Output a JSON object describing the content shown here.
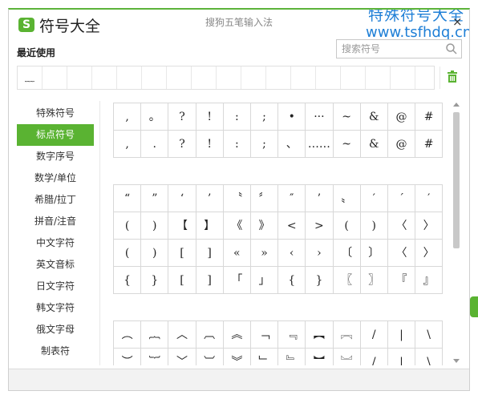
{
  "window": {
    "title": "符号大全",
    "subtitle": "搜狗五笔输入法",
    "logo_letter": "S",
    "close_glyph": "×"
  },
  "watermark": {
    "line1": "特殊符号大全",
    "line2": "www.tsfhdq.cn"
  },
  "recent": {
    "label": "最近使用",
    "items": [
      "﹏",
      "",
      "",
      "",
      "",
      "",
      "",
      "",
      "",
      "",
      "",
      "",
      "",
      "",
      "",
      "",
      ""
    ]
  },
  "search": {
    "placeholder": "搜索符号",
    "value": ""
  },
  "sidebar": {
    "items": [
      {
        "label": "特殊符号",
        "active": false
      },
      {
        "label": "标点符号",
        "active": true
      },
      {
        "label": "数字序号",
        "active": false
      },
      {
        "label": "数学/单位",
        "active": false
      },
      {
        "label": "希腊/拉丁",
        "active": false
      },
      {
        "label": "拼音/注音",
        "active": false
      },
      {
        "label": "中文字符",
        "active": false
      },
      {
        "label": "英文音标",
        "active": false
      },
      {
        "label": "日文字符",
        "active": false
      },
      {
        "label": "韩文字符",
        "active": false
      },
      {
        "label": "俄文字母",
        "active": false
      },
      {
        "label": "制表符",
        "active": false
      }
    ]
  },
  "symbols": {
    "group1": [
      ",",
      "。",
      "?",
      "!",
      ":",
      ";",
      "•",
      "···",
      "~",
      "&",
      "@",
      "#",
      ",",
      ".",
      "?",
      "!",
      ":",
      ";",
      "、",
      "……",
      "~",
      "&",
      "@",
      "#"
    ],
    "group2": [
      "“",
      "”",
      "‘",
      "’",
      "〝",
      "〞",
      "″",
      "’",
      "〟",
      "′",
      "´",
      "′",
      "(",
      ")",
      "【",
      "】",
      "《",
      "》",
      "<",
      ">",
      "(",
      ")",
      "〈",
      "〉",
      "(",
      ")",
      "[",
      "]",
      "«",
      "»",
      "‹",
      "›",
      "〔",
      "〕",
      "〈",
      "〉",
      "{",
      "}",
      "[",
      "]",
      "「",
      "」",
      "{",
      "}",
      "〖",
      "〗",
      "『",
      "』"
    ],
    "group3": [
      "︵",
      "︷",
      "︿",
      "︹",
      "︽",
      "﹁",
      "﹃",
      "︻",
      "︗",
      "/",
      "|",
      "\\",
      "︶",
      "︸",
      "﹀",
      "︺",
      "︾",
      "﹂",
      "﹄",
      "︼",
      "︘",
      "/",
      "|",
      "\\"
    ]
  },
  "colors": {
    "accent": "#5ab332",
    "watermark": "#1f7fd6"
  }
}
